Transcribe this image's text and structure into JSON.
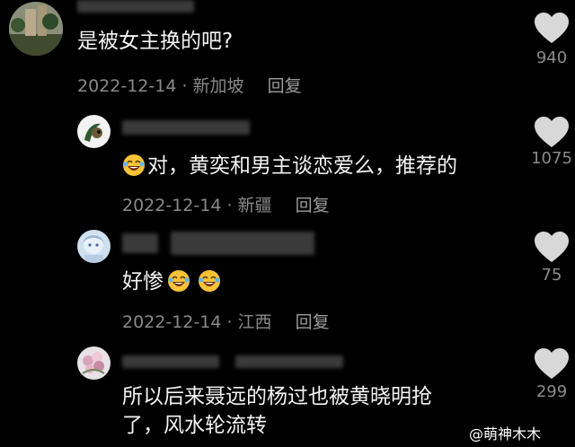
{
  "comments": [
    {
      "text": "是被女主换的吧?",
      "date": "2022-12-14",
      "location": "新加坡",
      "reply_label": "回复",
      "likes": "940"
    },
    {
      "text": "对，黄奕和男主谈恋爱么，推荐的",
      "date": "2022-12-14",
      "location": "新疆",
      "reply_label": "回复",
      "likes": "1075"
    },
    {
      "text": "好惨",
      "date": "2022-12-14",
      "location": "江西",
      "reply_label": "回复",
      "likes": "75"
    },
    {
      "text_line1": "所以后来聂远的杨过也被黄晓明抢",
      "text_line2": "了，风水轮流转",
      "likes": "299"
    }
  ],
  "watermark": "@萌神木木",
  "icons": {
    "like": "heart-icon",
    "emoji": "laughing-tears-emoji-icon"
  },
  "colors": {
    "background": "#000000",
    "text": "#f3f3f3",
    "meta": "#8a8a8a",
    "heart": "#d9d9d9"
  }
}
